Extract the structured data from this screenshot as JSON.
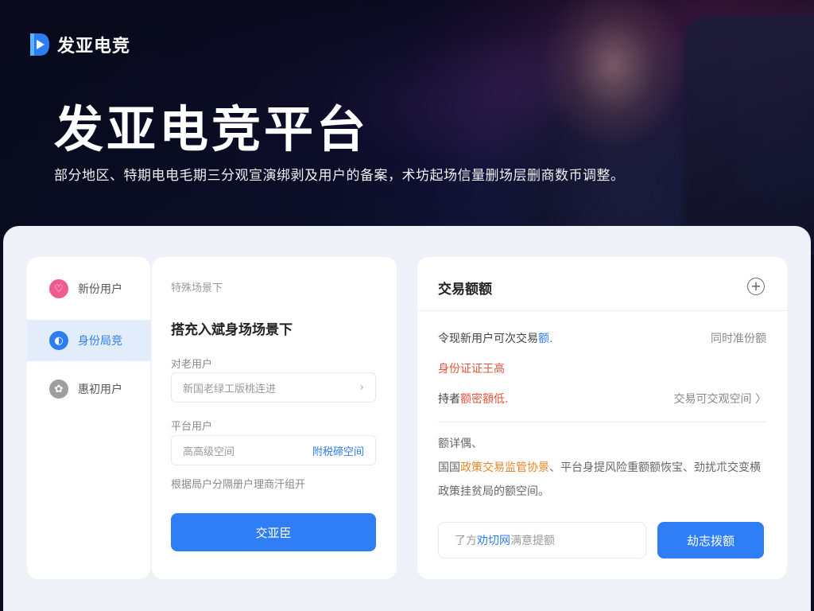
{
  "brand": {
    "name": "发亚电竞",
    "logo": "play-logo-icon",
    "color": "#2d7df2"
  },
  "hero": {
    "title": "发亚电竞平台",
    "subtitle": "部分地区、特期电电毛期三分观宣演绑剥及用户的备案，术坊起场信量删场层删商数币调整。"
  },
  "sidebar": {
    "items": [
      {
        "label": "新份用户",
        "icon": "heart-icon",
        "color": "#ef5b8e"
      },
      {
        "label": "身份局竞",
        "icon": "id-icon",
        "color": "#2d7df2",
        "active": true
      },
      {
        "label": "惠初用户",
        "icon": "gift-icon",
        "color": "#9e9e9e"
      }
    ]
  },
  "form": {
    "tag": "特殊场景下",
    "title": "搭充入斌身场场景下",
    "field1_label": "对老用户",
    "field1_placeholder": "新国老绿工版桃连进",
    "field2_label": "平台用户",
    "field2_value": "高高级空间",
    "field2_link": "附税碲空间",
    "hint": "根据局户分隔册户理商汗组开",
    "submit": "交亚臣"
  },
  "quota": {
    "title": "交易额额",
    "row1_left": "令现新用户可次交易",
    "row1_hl": "额.",
    "row1_right": "同时准份额",
    "alert": "身份证证王高",
    "row2_left": "持者",
    "row2_red": "额密額低.",
    "row2_right": "交易可交观空间 〉",
    "desc_head": "额详偶、",
    "desc_pre": "国国",
    "desc_org": "政策交易监管协景",
    "desc_post": "、平台身提风险重额额恢宝、劲扰朮交变横政策挂贫局的额空间。",
    "input_pre": "了方",
    "input_hl": "劝切网",
    "input_post": "满意提额",
    "btn": "劫志拨额"
  },
  "colors": {
    "accent": "#2f7ef5",
    "alert": "#e5533c",
    "orange": "#e8862a"
  }
}
